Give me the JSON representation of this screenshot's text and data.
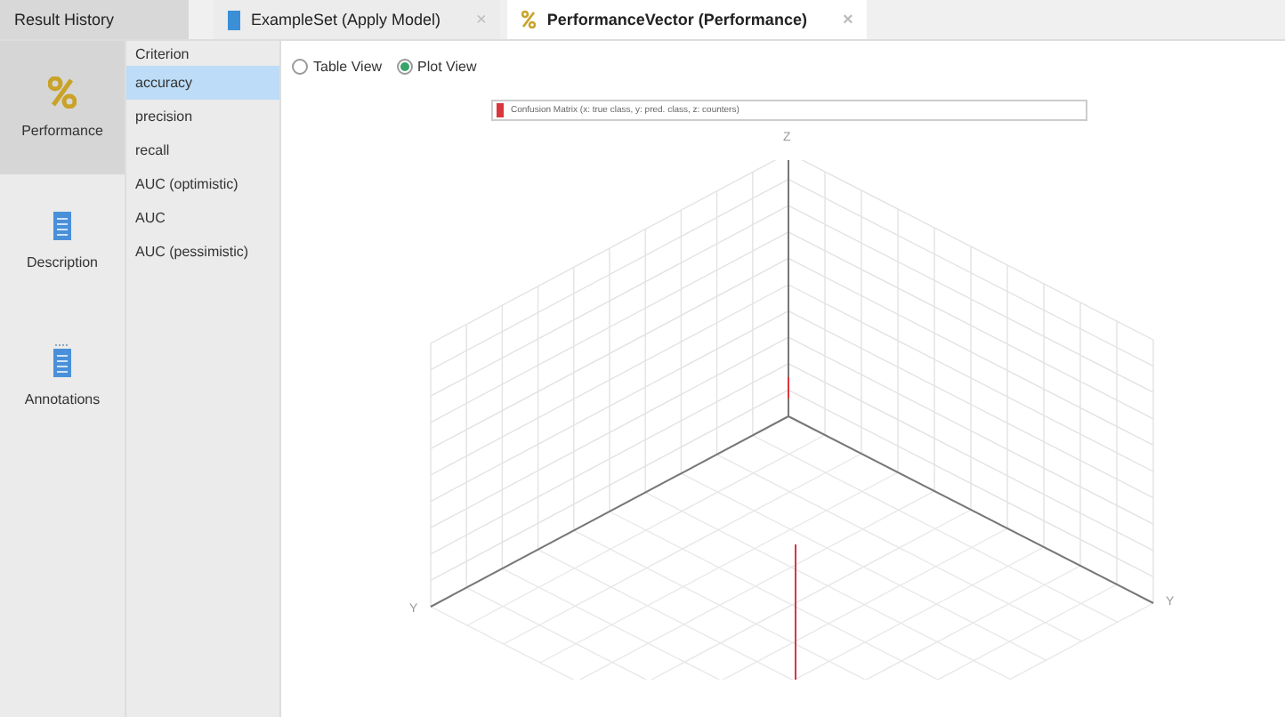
{
  "tabs": [
    {
      "label": "Result History",
      "kind": "history",
      "selected": false
    },
    {
      "label": "ExampleSet (Apply Model)",
      "kind": "data",
      "selected": false,
      "close": "×"
    },
    {
      "label": "PerformanceVector (Performance)",
      "kind": "performance",
      "selected": true,
      "close": "×"
    }
  ],
  "sidebar": {
    "items": [
      {
        "label": "Performance",
        "kind": "performance",
        "selected": true
      },
      {
        "label": "Description",
        "kind": "document",
        "selected": false
      },
      {
        "label": "Annotations",
        "kind": "notes",
        "selected": false
      }
    ]
  },
  "criterion": {
    "header": "Criterion",
    "items": [
      {
        "label": "accuracy",
        "selected": true
      },
      {
        "label": "precision",
        "selected": false
      },
      {
        "label": "recall",
        "selected": false
      },
      {
        "label": "AUC (optimistic)",
        "selected": false
      },
      {
        "label": "AUC",
        "selected": false
      },
      {
        "label": "AUC (pessimistic)",
        "selected": false
      }
    ]
  },
  "views": [
    {
      "label": "Table View",
      "selected": false
    },
    {
      "label": "Plot View",
      "selected": true
    }
  ],
  "plot": {
    "legend": {
      "label": "Confusion Matrix (x: true class, y: pred. class, z: counters)",
      "color": "#d9363e"
    },
    "axis_labels": {
      "z": "Z",
      "left": "Y",
      "right": "Y"
    }
  }
}
